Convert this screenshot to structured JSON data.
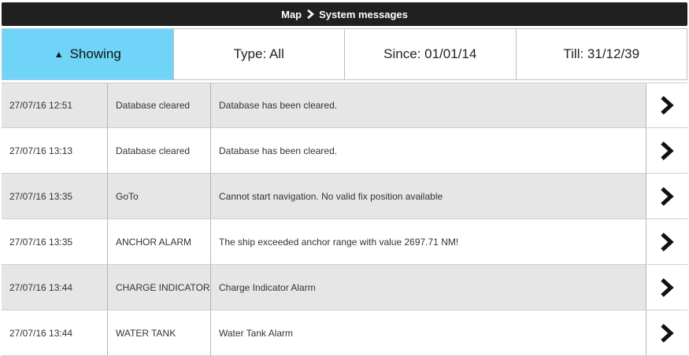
{
  "header": {
    "crumb_parent": "Map",
    "crumb_current": "System messages"
  },
  "filters": {
    "showing_label": "Showing",
    "type_label": "Type: All",
    "since_label": "Since: 01/01/14",
    "till_label": "Till: 31/12/39"
  },
  "messages": [
    {
      "datetime": "27/07/16 12:51",
      "type": "Database cleared",
      "message": "Database has been cleared."
    },
    {
      "datetime": "27/07/16 13:13",
      "type": "Database cleared",
      "message": "Database has been cleared."
    },
    {
      "datetime": "27/07/16 13:35",
      "type": "GoTo",
      "message": "Cannot start navigation. No valid fix position available"
    },
    {
      "datetime": "27/07/16 13:35",
      "type": "ANCHOR ALARM",
      "message": "The ship exceeded anchor range with value 2697.71 NM!"
    },
    {
      "datetime": "27/07/16 13:44",
      "type": "CHARGE INDICATOR",
      "message": "Charge Indicator Alarm"
    },
    {
      "datetime": "27/07/16 13:44",
      "type": "WATER TANK",
      "message": "Water Tank Alarm"
    }
  ],
  "colors": {
    "titlebar": "#202020",
    "active_filter": "#6fd4f7",
    "row_alt": "#e6e6e6",
    "row_plain": "#ffffff"
  },
  "icons": {
    "breadcrumb_separator": "chevron-right-icon",
    "row_action": "chevron-right-icon",
    "sort_indicator": "triangle-up-icon"
  }
}
